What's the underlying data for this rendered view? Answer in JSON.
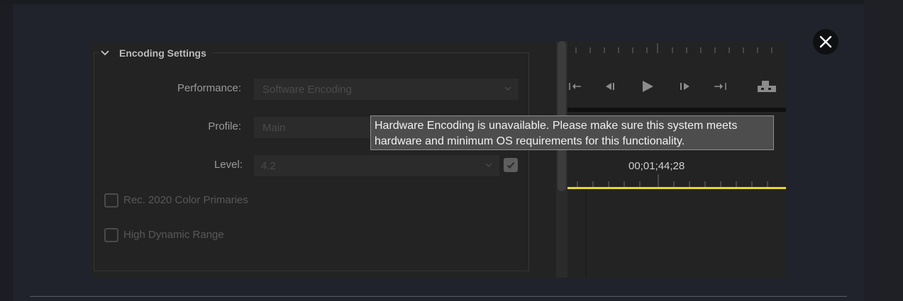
{
  "encoding": {
    "title": "Encoding Settings",
    "performance": {
      "label": "Performance:",
      "value": "Software Encoding"
    },
    "profile": {
      "label": "Profile:",
      "value": "Main"
    },
    "level": {
      "label": "Level:",
      "value": "4.2",
      "checked": true
    },
    "rec2020": {
      "label": "Rec. 2020 Color Primaries",
      "checked": false
    },
    "hdr": {
      "label": "High Dynamic Range",
      "checked": false
    }
  },
  "tooltip": {
    "line1": "Hardware Encoding is unavailable. Please make sure this system meets",
    "line2": "hardware and minimum OS requirements for this functionality."
  },
  "timeline": {
    "timecode": "00;01;44;28",
    "playhead_color": "#e8d82a"
  },
  "icons": {
    "close": "close-icon",
    "collapse": "chevron-down-icon",
    "transport": [
      "go-to-in-icon",
      "step-back-icon",
      "play-icon",
      "step-forward-icon",
      "go-to-out-icon",
      "export-frame-icon"
    ]
  }
}
